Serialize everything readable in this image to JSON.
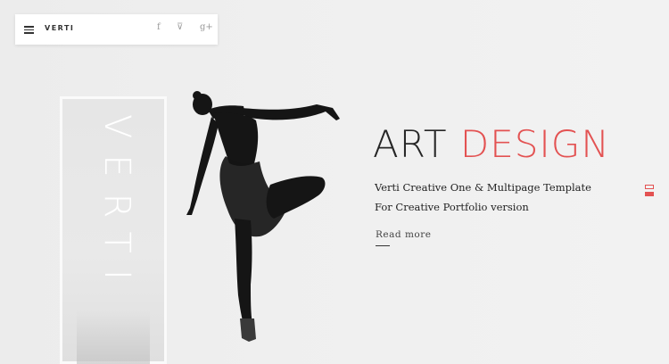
{
  "nav": {
    "brand": "VERTI",
    "social": [
      {
        "icon": "facebook-icon",
        "glyph": "f"
      },
      {
        "icon": "foursquare-icon",
        "glyph": "⊽"
      },
      {
        "icon": "google-plus-icon",
        "glyph": "g+"
      }
    ]
  },
  "frame": {
    "vertical_word": "VERTI"
  },
  "hero": {
    "title_dark": "ART",
    "title_accent": "DESIGN",
    "subtitle_line1": "Verti Creative One & Multipage Template",
    "subtitle_line2": "For Creative Portfolio version",
    "read_more": "Read more"
  },
  "colors": {
    "accent": "#e35252",
    "dark": "#262626",
    "background": "#efefef"
  },
  "slider": {
    "dots": [
      {
        "active": false
      },
      {
        "active": true
      }
    ]
  }
}
